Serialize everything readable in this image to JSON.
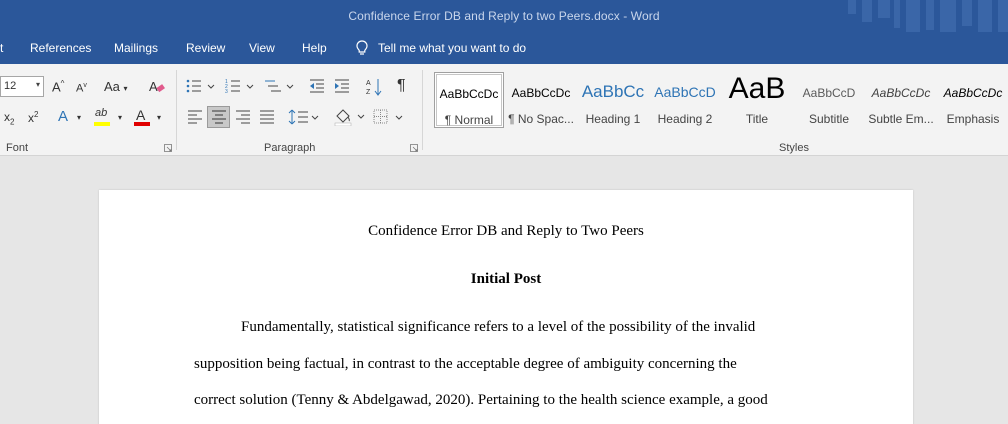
{
  "window": {
    "title": "Confidence Error DB and Reply to two Peers.docx  -  Word"
  },
  "tabs": [
    {
      "label": "t"
    },
    {
      "label": "References"
    },
    {
      "label": "Mailings"
    },
    {
      "label": "Review"
    },
    {
      "label": "View"
    },
    {
      "label": "Help"
    }
  ],
  "tell_me": {
    "label": "Tell me what you want to do",
    "icon": "lightbulb-icon"
  },
  "ribbon": {
    "font": {
      "group_label": "Font",
      "font_size": "12",
      "grow_label": "A",
      "shrink_label": "A",
      "change_case_label": "Aa",
      "subscript_label": "x",
      "superscript_label": "x",
      "text_effects_label": "A",
      "highlight_label": "ab",
      "font_color_label": "A",
      "highlight_color": "#ffff00",
      "font_color": "#e00000"
    },
    "paragraph": {
      "group_label": "Paragraph",
      "pilcrow": "¶"
    },
    "styles": {
      "group_label": "Styles",
      "items": [
        {
          "sample": "AaBbCcDc",
          "name": "¶ Normal",
          "selected": true
        },
        {
          "sample": "AaBbCcDc",
          "name": "¶ No Spac...",
          "selected": false
        },
        {
          "sample": "AaBbCc",
          "name": "Heading 1",
          "selected": false
        },
        {
          "sample": "AaBbCcD",
          "name": "Heading 2",
          "selected": false
        },
        {
          "sample": "AaB",
          "name": "Title",
          "selected": false
        },
        {
          "sample": "AaBbCcD",
          "name": "Subtitle",
          "selected": false
        },
        {
          "sample": "AaBbCcDc",
          "name": "Subtle Em...",
          "selected": false
        },
        {
          "sample": "AaBbCcDc",
          "name": "Emphasis",
          "selected": false
        }
      ],
      "heading_color": "#2e74b5"
    }
  },
  "document": {
    "title": "Confidence Error DB and Reply to Two Peers",
    "heading": "Initial Post",
    "lines": [
      "Fundamentally, statistical significance refers to a level of the possibility of the invalid",
      "supposition being factual, in contrast to the acceptable degree of ambiguity concerning the",
      "correct solution (Tenny & Abdelgawad, 2020). Pertaining to the health science example, a good"
    ]
  },
  "colors": {
    "accent": "#2b579a",
    "ribbon_bg": "#f3f3f3",
    "canvas_bg": "#e6e6e6"
  }
}
